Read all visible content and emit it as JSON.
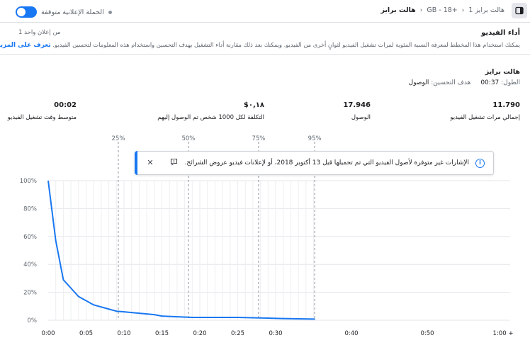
{
  "topbar": {
    "panel_icon": "sidebar-panel-icon",
    "crumb_ad_set": "هالت برايز 1",
    "crumb_audience": "GB - 18+",
    "crumb_ad": "هالت برايز",
    "campaign_status": "الحملة الإعلانية متوقفة",
    "toggle_on": true
  },
  "section": {
    "title": "أداء الفيديو",
    "shared_count": "1 من إعلان واحد",
    "description": "يمكنك استخدام هذا المخطط لمعرفة النسبة المئوية لمرات تشغيل الفيديو لثوانٍ أخرى من الفيديو. ويمكنك بعد ذلك مقارنة أداء التشغيل بهدف التحسين واستخدام هذه المعلومات لتحسين الفيديو.",
    "learn_more": "تعرف على المزيد"
  },
  "ad": {
    "name": "هالت برايز",
    "length_label": "الطول:",
    "length_value": "00:37",
    "goal_label": "هدف التحسين:",
    "goal_value": "الوصول"
  },
  "metrics": [
    {
      "value": "11.790",
      "label": "إجمالي مرات تشغيل الفيديو"
    },
    {
      "value": "17.946",
      "label": "الوصول"
    },
    {
      "value": "٠,١٨$",
      "label": "التكلفة لكل 1000 شخص تم الوصول إليهم"
    },
    {
      "value": "00:02",
      "label": "متوسط وقت تشغيل الفيديو"
    }
  ],
  "notice": {
    "text": "الإشارات غير متوفرة لأصول الفيديو التي تم تحميلها قبل 13 أكتوبر 2018، أو لإعلانات فيديو عروض الشرائح.",
    "info_icon": "info-icon",
    "report_icon": "report-icon",
    "close_icon": "close-icon"
  },
  "chart_data": {
    "type": "line",
    "xlabel": "",
    "ylabel": "",
    "x_ticks": [
      "0:00",
      "0:05",
      "0:10",
      "0:15",
      "0:20",
      "0:25",
      "0:30",
      "0:40",
      "0:50",
      "1:00 +"
    ],
    "y_ticks": [
      "0%",
      "20%",
      "40%",
      "60%",
      "80%",
      "100%"
    ],
    "ylim": [
      0,
      100
    ],
    "xlim_seconds": [
      0,
      60
    ],
    "color": "#1877f2",
    "quartile_markers": [
      {
        "label": "25%",
        "x_seconds": 9.25
      },
      {
        "label": "50%",
        "x_seconds": 18.5
      },
      {
        "label": "75%",
        "x_seconds": 27.75
      },
      {
        "label": "95%",
        "x_seconds": 35.15
      }
    ],
    "series": [
      {
        "x_seconds": [
          0,
          1,
          2,
          4,
          6,
          8,
          9,
          10,
          11,
          12,
          13,
          14,
          15,
          17,
          19,
          21,
          23,
          25,
          27,
          29,
          31,
          33,
          35.2
        ],
        "values": [
          100,
          57,
          29,
          17,
          11,
          8,
          6.5,
          6,
          5.5,
          5,
          4.5,
          4,
          3,
          2.5,
          2,
          2,
          2,
          2,
          1.8,
          1.5,
          1.2,
          1,
          0.8
        ]
      }
    ]
  }
}
